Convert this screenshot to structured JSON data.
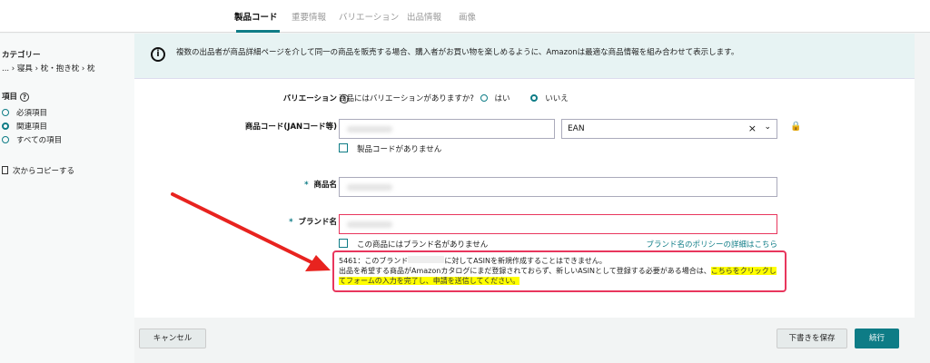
{
  "tabs": [
    {
      "label": "製品コード",
      "active": true
    },
    {
      "label": "重要情報"
    },
    {
      "label": "バリエーション"
    },
    {
      "label": "出品情報"
    },
    {
      "label": "画像"
    }
  ],
  "sidebar": {
    "category_title": "カテゴリー",
    "breadcrumb": "... › 寝具 › 枕・抱き枕 › 枕",
    "items_title": "項目",
    "items": [
      {
        "label": "必須項目",
        "selected": false
      },
      {
        "label": "関連項目",
        "selected": true
      },
      {
        "label": "すべての項目",
        "selected": false
      }
    ],
    "copy_label": "次からコピーする"
  },
  "banner": {
    "text": "複数の出品者が商品詳細ページを介して同一の商品を販売する場合、購入者がお買い物を楽しめるように、Amazonは最適な商品情報を組み合わせて表示します。"
  },
  "form": {
    "variation": {
      "label": "バリエーション",
      "question": "商品にはバリエーションがありますか?",
      "options": [
        "はい",
        "いいえ"
      ],
      "selected": "いいえ"
    },
    "product_code": {
      "label": "商品コード(JANコード等)",
      "type_value": "EAN",
      "no_code_label": "製品コードがありません"
    },
    "product_name": {
      "label": "商品名"
    },
    "brand": {
      "label": "ブランド名",
      "no_brand_label": "この商品にはブランド名がありません",
      "policy_link": "ブランド名のポリシーの詳細はこちら"
    },
    "error": {
      "line1a": "5461：このブランド",
      "line1b": "に対してASINを新規作成することはできません。",
      "line2": "出品を希望する商品がAmazonカタログにまだ登録されておらず、新しいASINとして登録する必要がある場合は、",
      "link": "こちらをクリックしてフォームの入力を完了し、申請を送信してください。"
    }
  },
  "footer": {
    "cancel": "キャンセル",
    "save_draft": "下書きを保存",
    "continue": "続行"
  },
  "colors": {
    "accent": "#0e7c86",
    "error": "#e8365d",
    "highlight": "#ffff00",
    "arrow": "#e8231f"
  }
}
